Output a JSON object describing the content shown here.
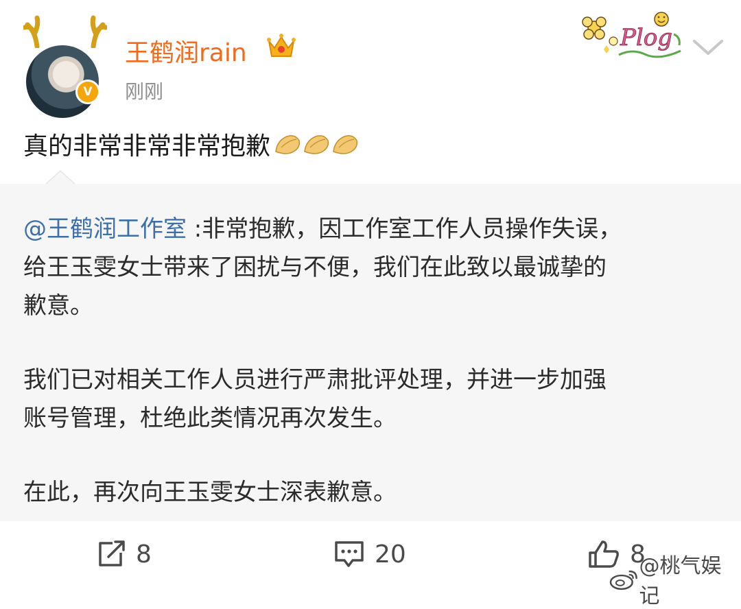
{
  "post": {
    "username": "王鹤润rain",
    "timestamp": "刚刚",
    "text": "真的非常非常非常抱歉"
  },
  "repost": {
    "mention": "@王鹤润工作室",
    "line1_rest": " :非常抱歉，因工作室工作人员操作失误，",
    "line2": "给王玉雯女士带来了困扰与不便，我们在此致以最诚挚的",
    "line3": "歉意。",
    "para2_line1": "我们已对相关工作人员进行严肃批评处理，并进一步加强",
    "para2_line2": "账号管理，杜绝此类情况再次发生。",
    "para3": "在此，再次向王玉雯女士深表歉意。"
  },
  "actions": {
    "repost_count": "8",
    "comment_count": "20",
    "like_count": "8"
  },
  "badge": {
    "plog_text": "Plog"
  },
  "watermark": {
    "text": "@桃气娱记"
  },
  "colors": {
    "username": "#f26b1d",
    "mention": "#3d6fa8",
    "verified": "#f6a50b",
    "repost_bg": "#f6f6f6"
  },
  "icons": [
    "antler-icon",
    "crown-icon",
    "verified-icon",
    "plog-sticker-icon",
    "chevron-down-icon",
    "pinched-fingers-emoji-icon",
    "repost-icon",
    "comment-icon",
    "like-icon",
    "weibo-logo-icon"
  ]
}
